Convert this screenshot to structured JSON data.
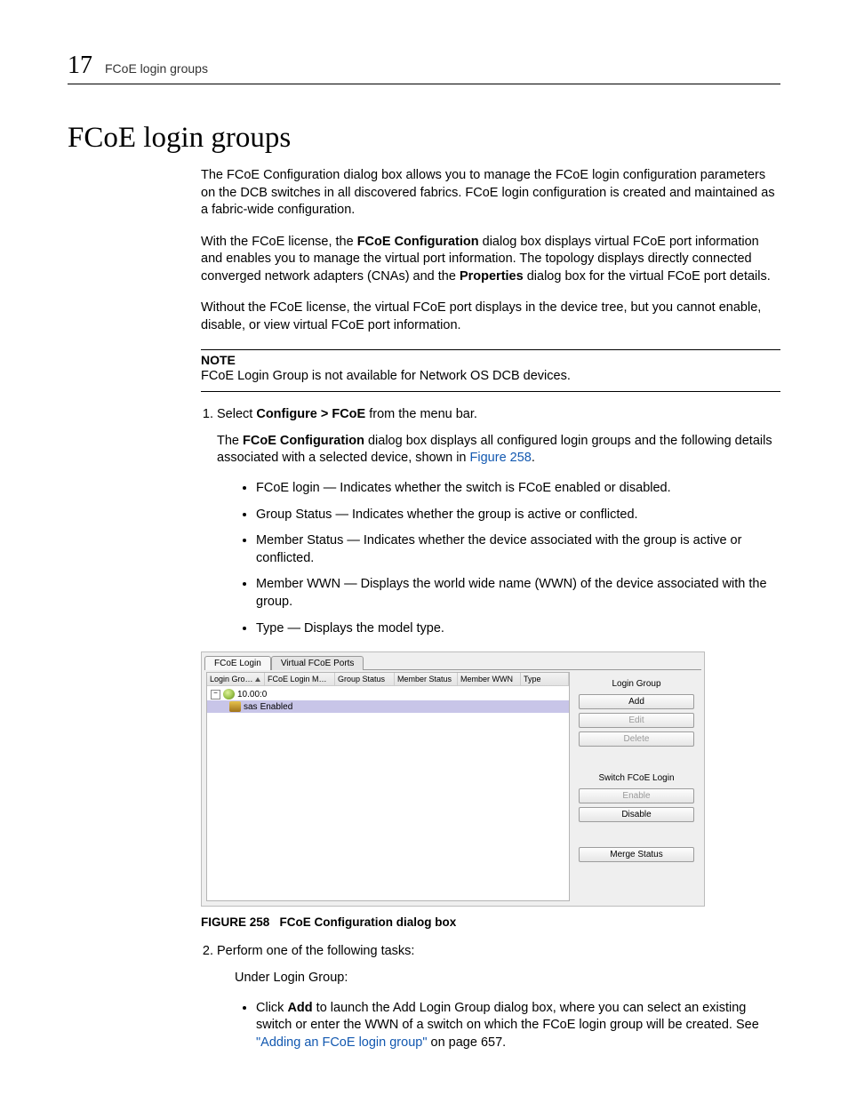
{
  "header": {
    "chapter_number": "17",
    "running_title": "FCoE login groups"
  },
  "heading": "FCoE login groups",
  "paragraphs": {
    "p1": "The FCoE Configuration dialog box allows you to manage the FCoE login configuration parameters on the DCB switches in all discovered fabrics. FCoE login configuration is created and maintained as a fabric-wide configuration.",
    "p2a": "With the FCoE license, the ",
    "p2b": "FCoE Configuration",
    "p2c": " dialog box displays virtual FCoE port information and enables you to manage the virtual port information. The topology displays directly connected converged network adapters (CNAs) and the ",
    "p2d": "Properties",
    "p2e": " dialog box for the virtual FCoE port details.",
    "p3": "Without the FCoE license, the virtual FCoE port displays in the device tree, but you cannot enable, disable, or view virtual FCoE port information."
  },
  "note": {
    "label": "NOTE",
    "body": "FCoE Login Group is not available for Network OS DCB devices."
  },
  "step1": {
    "lead": "Select ",
    "menu": "Configure > FCoE",
    "tail": " from the menu bar.",
    "desc_a": "The ",
    "desc_b": "FCoE Configuration",
    "desc_c": " dialog box displays all configured login groups and the following details associated with a selected device, shown in ",
    "desc_ref": "Figure 258",
    "desc_d": "."
  },
  "bullets1": [
    "FCoE login — Indicates whether the switch is FCoE enabled or disabled.",
    "Group Status — Indicates whether the group is active or conflicted.",
    "Member Status — Indicates whether the device associated with the group is active or conflicted.",
    "Member WWN — Displays the world wide name (WWN) of the device associated with the group.",
    "Type — Displays the model type."
  ],
  "dialog": {
    "tabs": [
      "FCoE Login",
      "Virtual FCoE Ports"
    ],
    "columns": [
      "Login Gro…",
      "FCoE Login M…",
      "Group Status",
      "Member Status",
      "Member WWN",
      "Type"
    ],
    "rows": {
      "root": "10.00:0",
      "child_a": "sas",
      "child_b": "Enabled"
    },
    "right_panel": {
      "group1_label": "Login Group",
      "btn_add": "Add",
      "btn_edit": "Edit",
      "btn_delete": "Delete",
      "group2_label": "Switch FCoE Login",
      "btn_enable": "Enable",
      "btn_disable": "Disable",
      "btn_merge": "Merge Status"
    }
  },
  "figure_caption": {
    "num": "FIGURE 258",
    "text": "FCoE Configuration dialog box"
  },
  "step2": {
    "lead": "Perform one of the following tasks:",
    "under": "Under Login Group:",
    "bullet_a": "Click ",
    "bullet_b": "Add",
    "bullet_c": " to launch the Add Login Group dialog box, where you can select an existing switch or enter the WWN of a switch on which the FCoE login group will be created. See ",
    "bullet_ref": "\"Adding an FCoE login group\"",
    "bullet_d": " on page 657."
  }
}
